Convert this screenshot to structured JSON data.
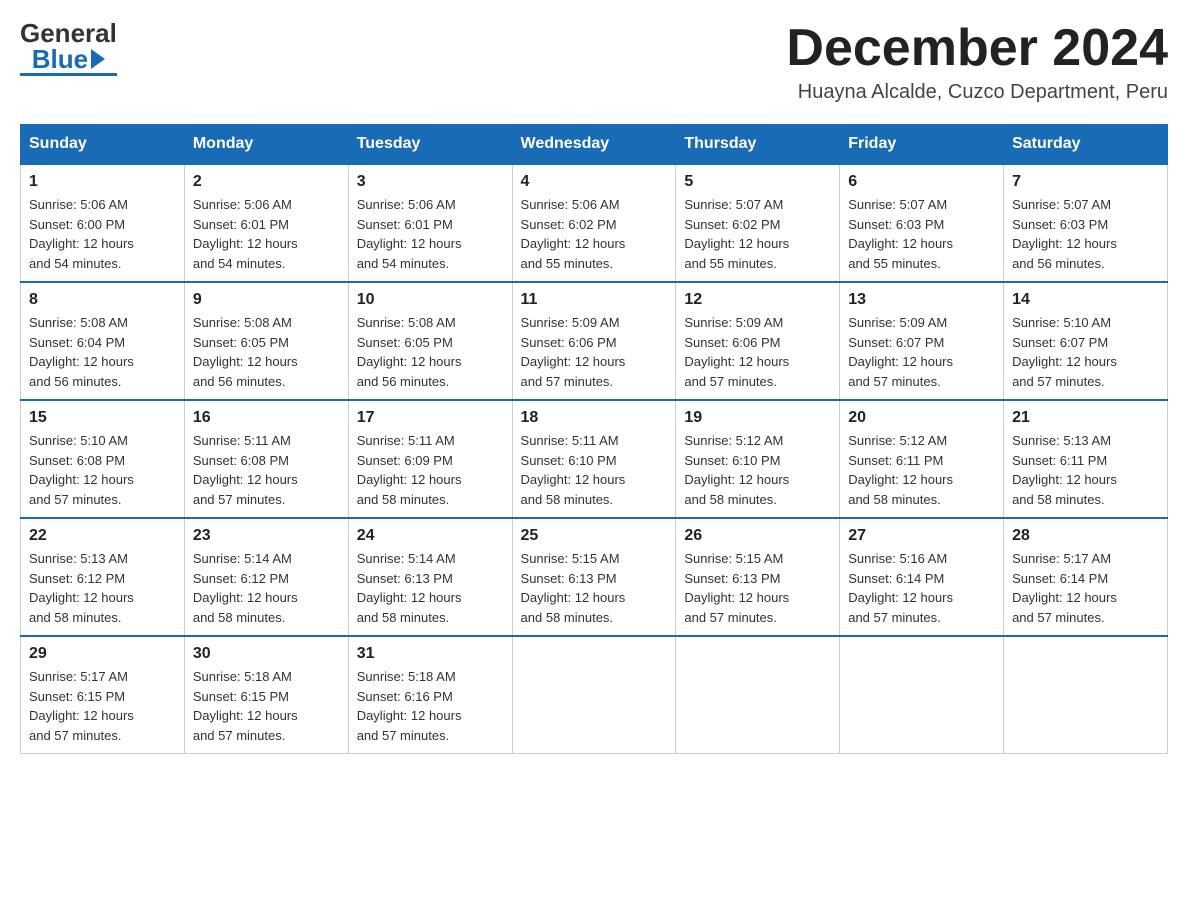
{
  "header": {
    "logo_general": "General",
    "logo_blue": "Blue",
    "month_title": "December 2024",
    "location": "Huayna Alcalde, Cuzco Department, Peru"
  },
  "days_of_week": [
    "Sunday",
    "Monday",
    "Tuesday",
    "Wednesday",
    "Thursday",
    "Friday",
    "Saturday"
  ],
  "weeks": [
    [
      {
        "day": "1",
        "sunrise": "Sunrise: 5:06 AM",
        "sunset": "Sunset: 6:00 PM",
        "daylight": "Daylight: 12 hours",
        "daylight2": "and 54 minutes."
      },
      {
        "day": "2",
        "sunrise": "Sunrise: 5:06 AM",
        "sunset": "Sunset: 6:01 PM",
        "daylight": "Daylight: 12 hours",
        "daylight2": "and 54 minutes."
      },
      {
        "day": "3",
        "sunrise": "Sunrise: 5:06 AM",
        "sunset": "Sunset: 6:01 PM",
        "daylight": "Daylight: 12 hours",
        "daylight2": "and 54 minutes."
      },
      {
        "day": "4",
        "sunrise": "Sunrise: 5:06 AM",
        "sunset": "Sunset: 6:02 PM",
        "daylight": "Daylight: 12 hours",
        "daylight2": "and 55 minutes."
      },
      {
        "day": "5",
        "sunrise": "Sunrise: 5:07 AM",
        "sunset": "Sunset: 6:02 PM",
        "daylight": "Daylight: 12 hours",
        "daylight2": "and 55 minutes."
      },
      {
        "day": "6",
        "sunrise": "Sunrise: 5:07 AM",
        "sunset": "Sunset: 6:03 PM",
        "daylight": "Daylight: 12 hours",
        "daylight2": "and 55 minutes."
      },
      {
        "day": "7",
        "sunrise": "Sunrise: 5:07 AM",
        "sunset": "Sunset: 6:03 PM",
        "daylight": "Daylight: 12 hours",
        "daylight2": "and 56 minutes."
      }
    ],
    [
      {
        "day": "8",
        "sunrise": "Sunrise: 5:08 AM",
        "sunset": "Sunset: 6:04 PM",
        "daylight": "Daylight: 12 hours",
        "daylight2": "and 56 minutes."
      },
      {
        "day": "9",
        "sunrise": "Sunrise: 5:08 AM",
        "sunset": "Sunset: 6:05 PM",
        "daylight": "Daylight: 12 hours",
        "daylight2": "and 56 minutes."
      },
      {
        "day": "10",
        "sunrise": "Sunrise: 5:08 AM",
        "sunset": "Sunset: 6:05 PM",
        "daylight": "Daylight: 12 hours",
        "daylight2": "and 56 minutes."
      },
      {
        "day": "11",
        "sunrise": "Sunrise: 5:09 AM",
        "sunset": "Sunset: 6:06 PM",
        "daylight": "Daylight: 12 hours",
        "daylight2": "and 57 minutes."
      },
      {
        "day": "12",
        "sunrise": "Sunrise: 5:09 AM",
        "sunset": "Sunset: 6:06 PM",
        "daylight": "Daylight: 12 hours",
        "daylight2": "and 57 minutes."
      },
      {
        "day": "13",
        "sunrise": "Sunrise: 5:09 AM",
        "sunset": "Sunset: 6:07 PM",
        "daylight": "Daylight: 12 hours",
        "daylight2": "and 57 minutes."
      },
      {
        "day": "14",
        "sunrise": "Sunrise: 5:10 AM",
        "sunset": "Sunset: 6:07 PM",
        "daylight": "Daylight: 12 hours",
        "daylight2": "and 57 minutes."
      }
    ],
    [
      {
        "day": "15",
        "sunrise": "Sunrise: 5:10 AM",
        "sunset": "Sunset: 6:08 PM",
        "daylight": "Daylight: 12 hours",
        "daylight2": "and 57 minutes."
      },
      {
        "day": "16",
        "sunrise": "Sunrise: 5:11 AM",
        "sunset": "Sunset: 6:08 PM",
        "daylight": "Daylight: 12 hours",
        "daylight2": "and 57 minutes."
      },
      {
        "day": "17",
        "sunrise": "Sunrise: 5:11 AM",
        "sunset": "Sunset: 6:09 PM",
        "daylight": "Daylight: 12 hours",
        "daylight2": "and 58 minutes."
      },
      {
        "day": "18",
        "sunrise": "Sunrise: 5:11 AM",
        "sunset": "Sunset: 6:10 PM",
        "daylight": "Daylight: 12 hours",
        "daylight2": "and 58 minutes."
      },
      {
        "day": "19",
        "sunrise": "Sunrise: 5:12 AM",
        "sunset": "Sunset: 6:10 PM",
        "daylight": "Daylight: 12 hours",
        "daylight2": "and 58 minutes."
      },
      {
        "day": "20",
        "sunrise": "Sunrise: 5:12 AM",
        "sunset": "Sunset: 6:11 PM",
        "daylight": "Daylight: 12 hours",
        "daylight2": "and 58 minutes."
      },
      {
        "day": "21",
        "sunrise": "Sunrise: 5:13 AM",
        "sunset": "Sunset: 6:11 PM",
        "daylight": "Daylight: 12 hours",
        "daylight2": "and 58 minutes."
      }
    ],
    [
      {
        "day": "22",
        "sunrise": "Sunrise: 5:13 AM",
        "sunset": "Sunset: 6:12 PM",
        "daylight": "Daylight: 12 hours",
        "daylight2": "and 58 minutes."
      },
      {
        "day": "23",
        "sunrise": "Sunrise: 5:14 AM",
        "sunset": "Sunset: 6:12 PM",
        "daylight": "Daylight: 12 hours",
        "daylight2": "and 58 minutes."
      },
      {
        "day": "24",
        "sunrise": "Sunrise: 5:14 AM",
        "sunset": "Sunset: 6:13 PM",
        "daylight": "Daylight: 12 hours",
        "daylight2": "and 58 minutes."
      },
      {
        "day": "25",
        "sunrise": "Sunrise: 5:15 AM",
        "sunset": "Sunset: 6:13 PM",
        "daylight": "Daylight: 12 hours",
        "daylight2": "and 58 minutes."
      },
      {
        "day": "26",
        "sunrise": "Sunrise: 5:15 AM",
        "sunset": "Sunset: 6:13 PM",
        "daylight": "Daylight: 12 hours",
        "daylight2": "and 57 minutes."
      },
      {
        "day": "27",
        "sunrise": "Sunrise: 5:16 AM",
        "sunset": "Sunset: 6:14 PM",
        "daylight": "Daylight: 12 hours",
        "daylight2": "and 57 minutes."
      },
      {
        "day": "28",
        "sunrise": "Sunrise: 5:17 AM",
        "sunset": "Sunset: 6:14 PM",
        "daylight": "Daylight: 12 hours",
        "daylight2": "and 57 minutes."
      }
    ],
    [
      {
        "day": "29",
        "sunrise": "Sunrise: 5:17 AM",
        "sunset": "Sunset: 6:15 PM",
        "daylight": "Daylight: 12 hours",
        "daylight2": "and 57 minutes."
      },
      {
        "day": "30",
        "sunrise": "Sunrise: 5:18 AM",
        "sunset": "Sunset: 6:15 PM",
        "daylight": "Daylight: 12 hours",
        "daylight2": "and 57 minutes."
      },
      {
        "day": "31",
        "sunrise": "Sunrise: 5:18 AM",
        "sunset": "Sunset: 6:16 PM",
        "daylight": "Daylight: 12 hours",
        "daylight2": "and 57 minutes."
      },
      null,
      null,
      null,
      null
    ]
  ]
}
